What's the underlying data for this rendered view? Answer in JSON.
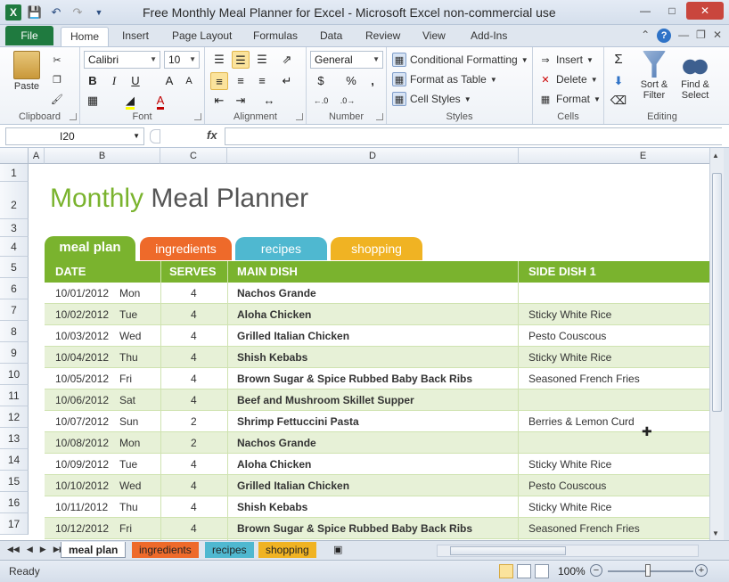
{
  "window": {
    "title": "Free Monthly Meal Planner for Excel  -  Microsoft Excel non-commercial use",
    "app_icon": "X",
    "controls": {
      "minimize": "—",
      "maximize": "□",
      "close": "✕"
    }
  },
  "ribbon_tabs": [
    "File",
    "Home",
    "Insert",
    "Page Layout",
    "Formulas",
    "Data",
    "Review",
    "View",
    "Add-Ins"
  ],
  "ribbon": {
    "clipboard": {
      "label": "Clipboard",
      "paste": "Paste"
    },
    "font": {
      "label": "Font",
      "name": "Calibri",
      "size": "10",
      "bold": "B",
      "italic": "I",
      "underline": "U",
      "grow": "A",
      "shrink": "A"
    },
    "alignment": {
      "label": "Alignment"
    },
    "number": {
      "label": "Number",
      "format": "General",
      "currency": "$",
      "percent": "%",
      "comma": ","
    },
    "styles": {
      "label": "Styles",
      "conditional": "Conditional Formatting",
      "format_table": "Format as Table",
      "cell_styles": "Cell Styles"
    },
    "cells": {
      "label": "Cells",
      "insert": "Insert",
      "delete": "Delete",
      "format": "Format"
    },
    "editing": {
      "label": "Editing",
      "sort": "Sort &",
      "sort2": "Filter",
      "find": "Find &",
      "find2": "Select"
    }
  },
  "formula_bar": {
    "name_box": "I20",
    "fx": "fx",
    "value": ""
  },
  "columns": [
    "A",
    "B",
    "C",
    "D",
    "E"
  ],
  "rows": [
    "1",
    "2",
    "3",
    "4",
    "5",
    "6",
    "7",
    "8",
    "9",
    "10",
    "11",
    "12",
    "13",
    "14",
    "15",
    "16",
    "17"
  ],
  "sheet": {
    "title_part1": "Monthly",
    "title_part2": "Meal Planner",
    "tabs": [
      {
        "label": "meal plan",
        "color": "#7ab32e"
      },
      {
        "label": "ingredients",
        "color": "#ee6a2a"
      },
      {
        "label": "recipes",
        "color": "#4fb8d0"
      },
      {
        "label": "shopping",
        "color": "#f0b323"
      }
    ],
    "headers": [
      "DATE",
      "SERVES",
      "MAIN DISH",
      "SIDE DISH 1"
    ],
    "entries": [
      {
        "date": "10/01/2012",
        "day": "Mon",
        "serves": "4",
        "main": "Nachos Grande",
        "side": ""
      },
      {
        "date": "10/02/2012",
        "day": "Tue",
        "serves": "4",
        "main": "Aloha Chicken",
        "side": "Sticky White Rice"
      },
      {
        "date": "10/03/2012",
        "day": "Wed",
        "serves": "4",
        "main": "Grilled Italian Chicken",
        "side": "Pesto Couscous"
      },
      {
        "date": "10/04/2012",
        "day": "Thu",
        "serves": "4",
        "main": "Shish Kebabs",
        "side": "Sticky White Rice"
      },
      {
        "date": "10/05/2012",
        "day": "Fri",
        "serves": "4",
        "main": "Brown Sugar & Spice Rubbed Baby Back Ribs",
        "side": "Seasoned French Fries"
      },
      {
        "date": "10/06/2012",
        "day": "Sat",
        "serves": "4",
        "main": "Beef and Mushroom Skillet Supper",
        "side": ""
      },
      {
        "date": "10/07/2012",
        "day": "Sun",
        "serves": "2",
        "main": "Shrimp Fettuccini Pasta",
        "side": "Berries & Lemon Curd"
      },
      {
        "date": "10/08/2012",
        "day": "Mon",
        "serves": "2",
        "main": "Nachos Grande",
        "side": ""
      },
      {
        "date": "10/09/2012",
        "day": "Tue",
        "serves": "4",
        "main": "Aloha Chicken",
        "side": "Sticky White Rice"
      },
      {
        "date": "10/10/2012",
        "day": "Wed",
        "serves": "4",
        "main": "Grilled Italian Chicken",
        "side": "Pesto Couscous"
      },
      {
        "date": "10/11/2012",
        "day": "Thu",
        "serves": "4",
        "main": "Shish Kebabs",
        "side": "Sticky White Rice"
      },
      {
        "date": "10/12/2012",
        "day": "Fri",
        "serves": "4",
        "main": "Brown Sugar & Spice Rubbed Baby Back Ribs",
        "side": "Seasoned French Fries"
      }
    ]
  },
  "sheet_tabs": [
    {
      "label": "meal plan",
      "color": "#ffffff"
    },
    {
      "label": "ingredients",
      "color": "#ee6a2a"
    },
    {
      "label": "recipes",
      "color": "#4fb8d0"
    },
    {
      "label": "shopping",
      "color": "#f0b323"
    }
  ],
  "status": {
    "text": "Ready",
    "zoom": "100%",
    "zoom_minus": "−",
    "zoom_plus": "+"
  }
}
